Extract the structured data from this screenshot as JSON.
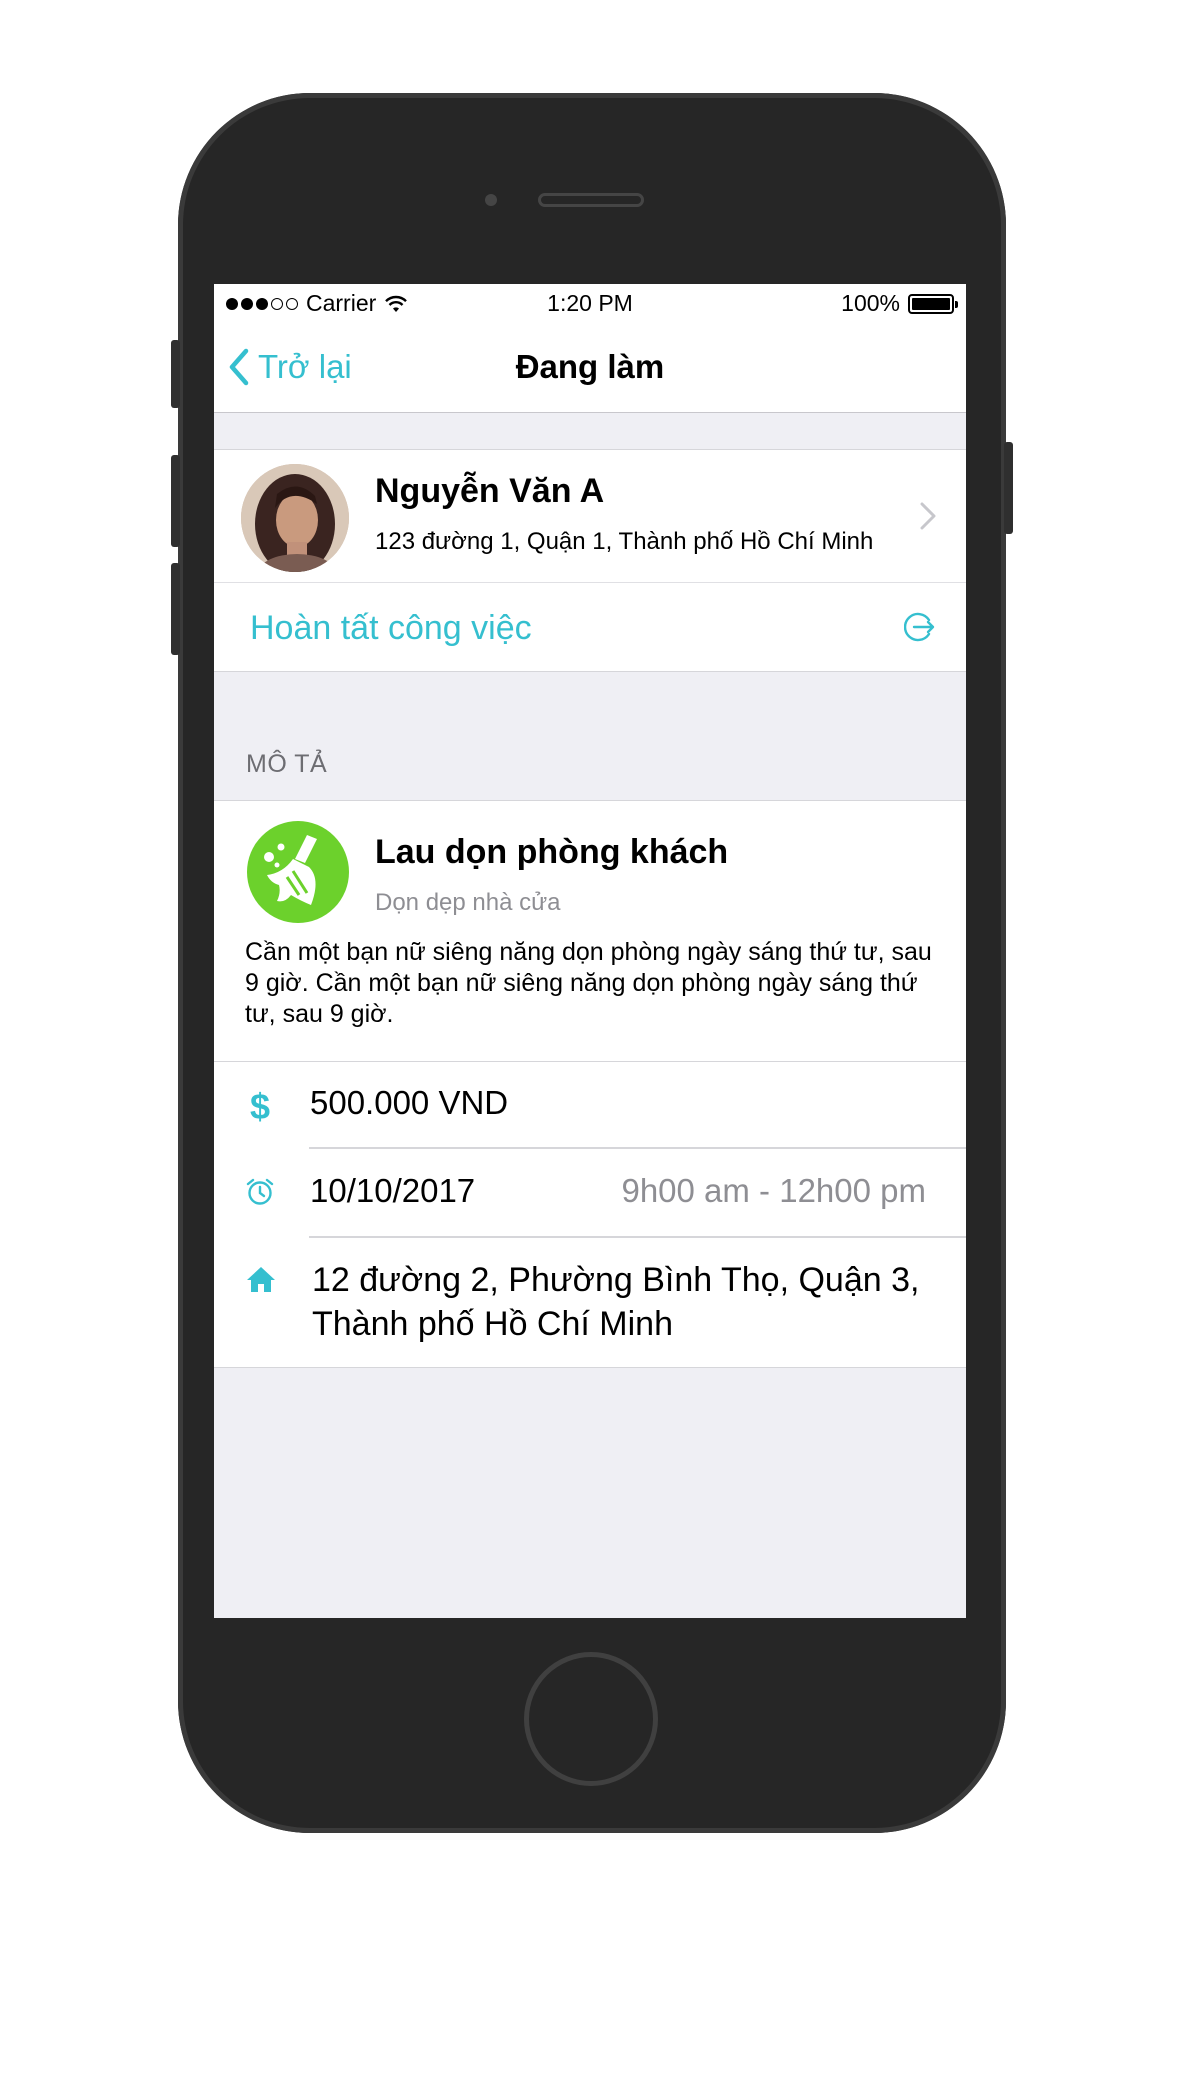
{
  "status_bar": {
    "carrier": "Carrier",
    "time": "1:20 PM",
    "battery": "100%"
  },
  "nav": {
    "back_label": "Trở lại",
    "title": "Đang làm"
  },
  "profile": {
    "name": "Nguyễn Văn A",
    "address": "123 đường 1, Quận 1, Thành phố Hồ Chí Minh"
  },
  "action": {
    "complete_label": "Hoàn tất công việc"
  },
  "section": {
    "description_header": "MÔ TẢ"
  },
  "task": {
    "title": "Lau dọn phòng khách",
    "category": "Dọn dẹp nhà cửa",
    "description": "Cần một bạn nữ siêng năng dọn phòng ngày sáng thứ tư, sau 9 giờ. Cần một bạn nữ siêng năng dọn phòng ngày sáng thứ tư, sau 9 giờ.",
    "price": "500.000 VND",
    "date": "10/10/2017",
    "time_range": "9h00 am - 12h00 pm",
    "address": "12 đường 2, Phường Bình Thọ, Quận 3, Thành phố Hồ Chí Minh"
  },
  "icons": [
    "back-chevron-icon",
    "wifi-icon",
    "battery-icon",
    "disclosure-chevron-icon",
    "exit-icon",
    "broom-icon",
    "dollar-icon",
    "alarm-icon",
    "home-icon"
  ],
  "colors": {
    "accent": "#35bfcf",
    "task_icon_bg": "#6cd12c",
    "frame": "#262626",
    "background": "#efeff4"
  }
}
